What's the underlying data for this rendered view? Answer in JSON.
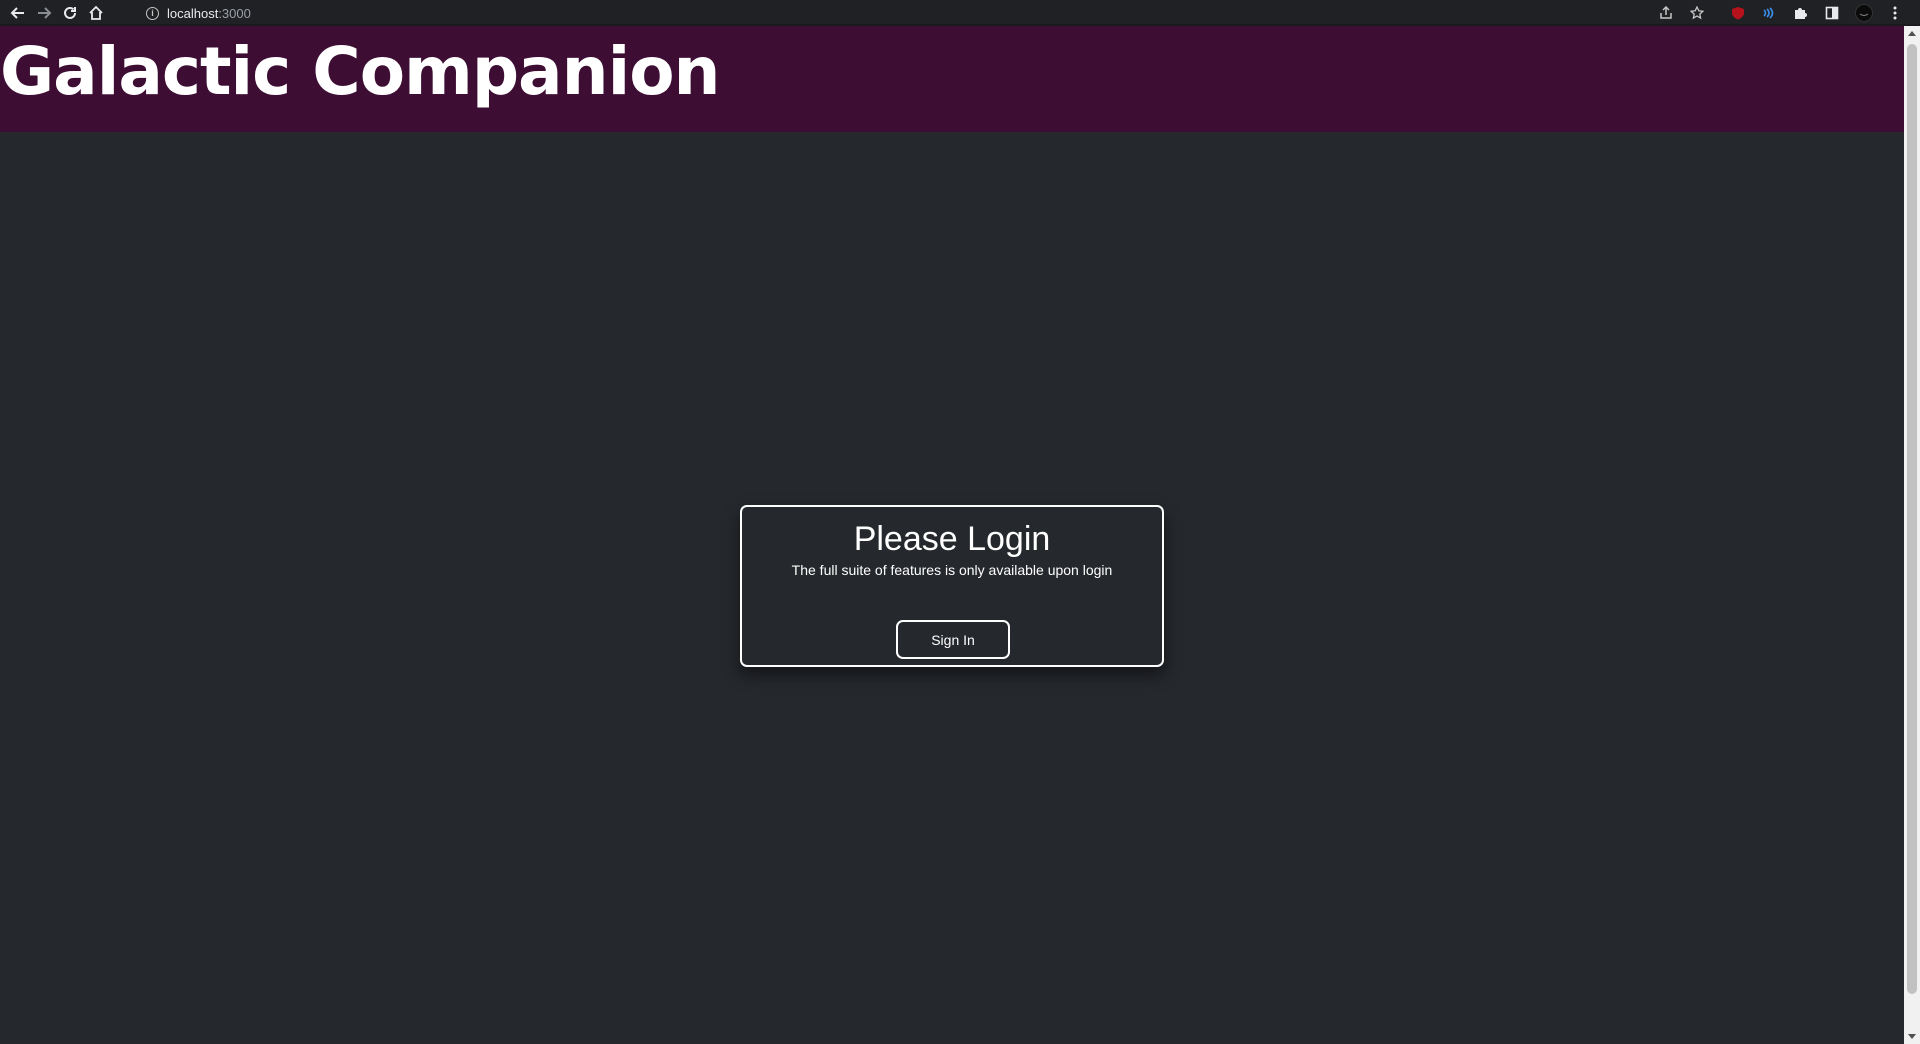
{
  "browser": {
    "url_host": "localhost",
    "url_port": ":3000",
    "icons": {
      "back": "arrow-left-icon",
      "forward": "arrow-right-icon",
      "reload": "reload-icon",
      "home": "home-icon",
      "site_info": "info-icon",
      "share": "share-icon",
      "bookmark": "star-icon",
      "ublock": "ublock-origin-icon",
      "extension_blue": "extension-icon",
      "extensions": "puzzle-icon",
      "side_panel": "side-panel-icon",
      "profile": "avatar",
      "menu": "kebab-menu-icon"
    }
  },
  "header": {
    "title": "Galactic Companion",
    "background_color": "#3d0d33"
  },
  "login": {
    "title": "Please Login",
    "subtitle": "The full suite of features is only available upon login",
    "button_label": "Sign In"
  },
  "colors": {
    "page_background": "#25282d",
    "text": "#ffffff"
  }
}
